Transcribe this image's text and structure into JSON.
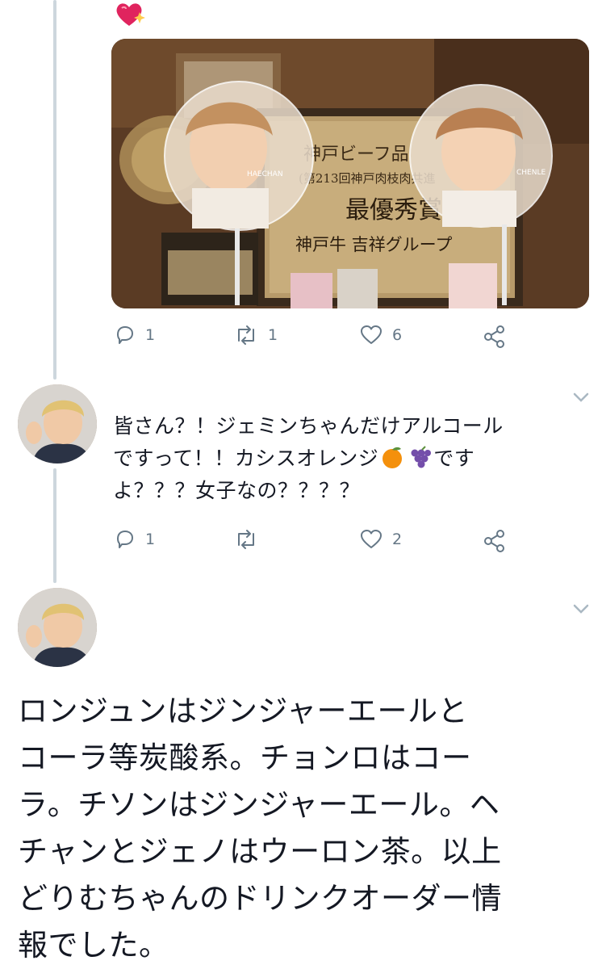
{
  "tweet1": {
    "media_caption_left": "HAECHAN",
    "media_caption_right": "CHENLE",
    "plaque_lines": [
      "神戸ビーフ品",
      "(第213回神戸肉枝肉共進",
      "最優秀賞",
      "神戸牛 吉祥グループ"
    ],
    "counts": {
      "reply": "1",
      "retweet": "1",
      "like": "6"
    }
  },
  "tweet2": {
    "text_line1": "皆さん？！ジェミンちゃんだけアルコール",
    "text_line2_a": "ですって！！カシスオレンジ",
    "text_line2_b": "です",
    "text_line3": "よ？？？女子なの？？？？",
    "counts": {
      "reply": "1",
      "retweet": "",
      "like": "2"
    }
  },
  "tweet3": {
    "lines": [
      "ロンジュンはジンジャーエールと",
      "コーラ等炭酸系。チョンロはコー",
      "ラ。チソンはジンジャーエール。ヘ",
      "チャンとジェノはウーロン茶。以上",
      "どりむちゃんのドリンクオーダー情",
      "報でした。"
    ]
  },
  "icons": [
    "sparkling-heart-icon",
    "reply-icon",
    "retweet-icon",
    "like-icon",
    "share-icon",
    "chevron-down-icon",
    "orange-icon",
    "grapes-icon"
  ],
  "colors": {
    "icon_gray": "#657786",
    "thread_line": "#cdd6dd",
    "text": "#141823"
  }
}
